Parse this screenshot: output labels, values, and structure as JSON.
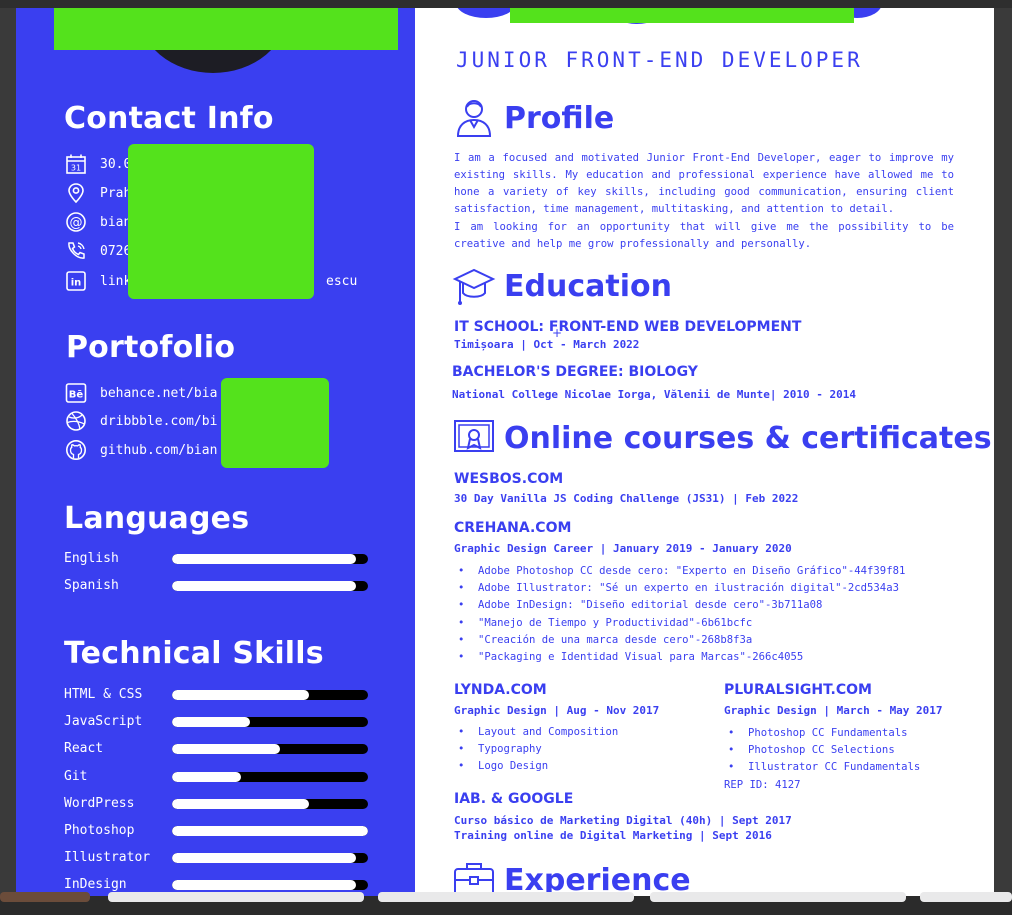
{
  "header": {
    "role": "JUNIOR FRONT-END DEVELOPER"
  },
  "sidebar": {
    "contact_title": "Contact Info",
    "contact": [
      {
        "icon": "calendar-icon",
        "text": "30.0"
      },
      {
        "icon": "location-pin-icon",
        "text": "Prah"
      },
      {
        "icon": "at-sign-icon",
        "text": "bian"
      },
      {
        "icon": "phone-icon",
        "text": "0726"
      },
      {
        "icon": "linkedin-icon",
        "text": "link",
        "text_tail": "escu"
      }
    ],
    "portfolio_title": "Portofolio",
    "portfolio": [
      {
        "icon": "behance-icon",
        "text": "behance.net/bia"
      },
      {
        "icon": "dribbble-icon",
        "text": "dribbble.com/bi"
      },
      {
        "icon": "github-icon",
        "text": "github.com/bian"
      }
    ],
    "languages_title": "Languages",
    "languages": [
      {
        "label": "English",
        "level": 0.94
      },
      {
        "label": "Spanish",
        "level": 0.94
      }
    ],
    "skills_title": "Technical Skills",
    "skills": [
      {
        "label": "HTML & CSS",
        "level": 0.7
      },
      {
        "label": "JavaScript",
        "level": 0.4
      },
      {
        "label": "React",
        "level": 0.55
      },
      {
        "label": "Git",
        "level": 0.35
      },
      {
        "label": "WordPress",
        "level": 0.7
      },
      {
        "label": "Photoshop",
        "level": 1.0
      },
      {
        "label": "Illustrator",
        "level": 0.94
      },
      {
        "label": "InDesign",
        "level": 0.94
      }
    ]
  },
  "main": {
    "profile_title": "Profile",
    "profile_p1": "I am a focused and motivated Junior Front-End Developer, eager to improve my existing skills. My education and professional experience have allowed me to hone a variety of key skills, including good communication, ensuring client satisfaction, time management, multitasking, and attention to detail.",
    "profile_p2": "I am looking for an opportunity that will give me the possibility to be creative and help me grow professionally and personally.",
    "education_title": "Education",
    "edu1_title": "IT SCHOOL: FRONT-END WEB DEVELOPMENT",
    "edu1_meta": "Timișoara | Oct - March 2022",
    "edu2_title": "BACHELOR'S DEGREE: BIOLOGY",
    "edu2_meta": "National College Nicolae Iorga, Vălenii de Munte| 2010 - 2014",
    "courses_title": "Online courses & certificates",
    "c1_title": "WESBOS.COM",
    "c1_meta": "30 Day Vanilla JS Coding Challenge (JS31) | Feb 2022",
    "c2_title": "CREHANA.COM",
    "c2_meta": "Graphic Design Career | January 2019 - January 2020",
    "c2_items": [
      "Adobe Photoshop CC desde cero: \"Experto en Diseño Gráfico\"-44f39f81",
      "Adobe Illustrator: \"Sé un experto en ilustración digital\"-2cd534a3",
      "Adobe InDesign: \"Diseño editorial desde cero\"-3b711a08",
      "\"Manejo de Tiempo y Productividad\"-6b61bcfc",
      "\"Creación de una marca desde cero\"-268b8f3a",
      "\"Packaging e Identidad Visual para Marcas\"-266c4055"
    ],
    "c3_title": "LYNDA.COM",
    "c3_meta": "Graphic Design | Aug - Nov 2017",
    "c3_items": [
      "Layout and Composition",
      "Typography",
      "Logo Design"
    ],
    "c4_title": "PLURALSIGHT.COM",
    "c4_meta": "Graphic Design | March - May 2017",
    "c4_items": [
      "Photoshop CC Fundamentals",
      "Photoshop CC Selections",
      "Illustrator CC Fundamentals"
    ],
    "c4_rep": "REP ID: 4127",
    "c5_title": "IAB. & GOOGLE",
    "c5_meta1": "Curso básico de Marketing Digital (40h) | Sept 2017",
    "c5_meta2": "Training online de Digital Marketing | Sept 2016",
    "experience_title": "Experience"
  }
}
